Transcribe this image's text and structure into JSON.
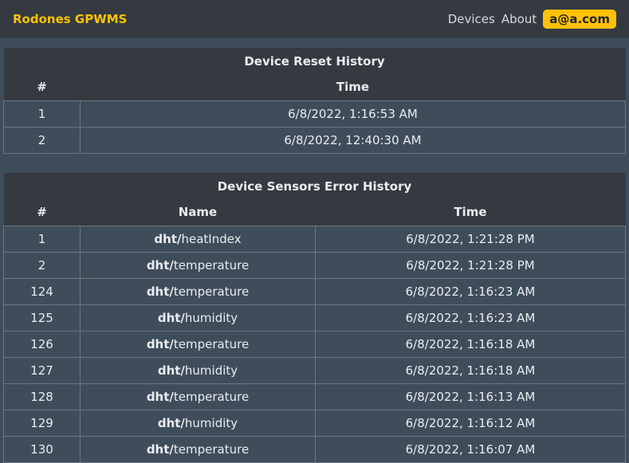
{
  "navbar": {
    "brand": "Rodones GPWMS",
    "links": [
      "Devices",
      "About"
    ],
    "user": "a@a.com"
  },
  "reset_history": {
    "title": "Device Reset History",
    "columns": [
      "#",
      "Time"
    ],
    "rows": [
      {
        "num": "1",
        "time": "6/8/2022, 1:16:53 AM"
      },
      {
        "num": "2",
        "time": "6/8/2022, 12:40:30 AM"
      }
    ]
  },
  "error_history": {
    "title": "Device Sensors Error History",
    "columns": [
      "#",
      "Name",
      "Time"
    ],
    "rows": [
      {
        "num": "1",
        "prefix": "dht/",
        "sensor": "heatIndex",
        "time": "6/8/2022, 1:21:28 PM"
      },
      {
        "num": "2",
        "prefix": "dht/",
        "sensor": "temperature",
        "time": "6/8/2022, 1:21:28 PM"
      },
      {
        "num": "124",
        "prefix": "dht/",
        "sensor": "temperature",
        "time": "6/8/2022, 1:16:23 AM"
      },
      {
        "num": "125",
        "prefix": "dht/",
        "sensor": "humidity",
        "time": "6/8/2022, 1:16:23 AM"
      },
      {
        "num": "126",
        "prefix": "dht/",
        "sensor": "temperature",
        "time": "6/8/2022, 1:16:18 AM"
      },
      {
        "num": "127",
        "prefix": "dht/",
        "sensor": "humidity",
        "time": "6/8/2022, 1:16:18 AM"
      },
      {
        "num": "128",
        "prefix": "dht/",
        "sensor": "temperature",
        "time": "6/8/2022, 1:16:13 AM"
      },
      {
        "num": "129",
        "prefix": "dht/",
        "sensor": "humidity",
        "time": "6/8/2022, 1:16:12 AM"
      },
      {
        "num": "130",
        "prefix": "dht/",
        "sensor": "temperature",
        "time": "6/8/2022, 1:16:07 AM"
      }
    ]
  }
}
